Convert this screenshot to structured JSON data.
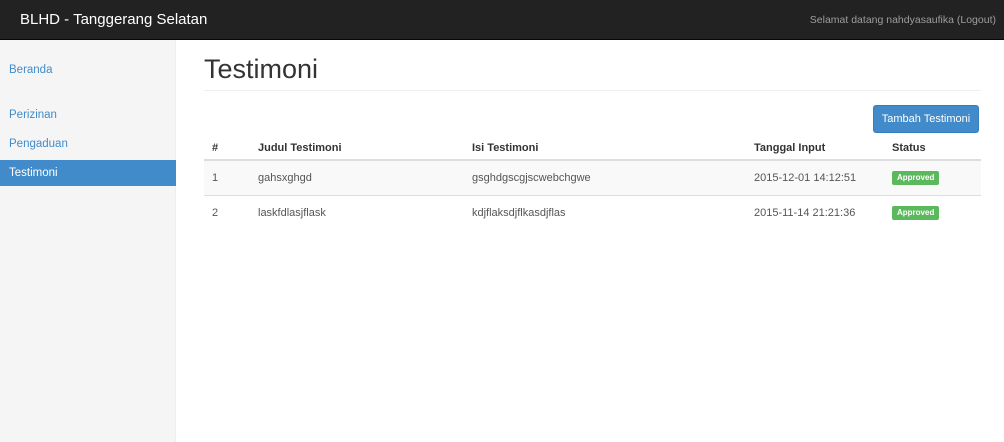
{
  "navbar": {
    "brand": "BLHD - Tanggerang Selatan",
    "welcome": "Selamat datang nahdyasaufika (Logout)"
  },
  "sidebar": {
    "items": [
      {
        "label": "Beranda",
        "active": false
      },
      {
        "label": "Perizinan",
        "active": false
      },
      {
        "label": "Pengaduan",
        "active": false
      },
      {
        "label": "Testimoni",
        "active": true
      }
    ]
  },
  "main": {
    "title": "Testimoni",
    "add_button": "Tambah Testimoni",
    "table": {
      "headers": [
        "#",
        "Judul Testimoni",
        "Isi Testimoni",
        "Tanggal Input",
        "Status"
      ],
      "rows": [
        {
          "no": "1",
          "judul": "gahsxghgd",
          "isi": "gsghdgscgjscwebchgwe",
          "tanggal": "2015-12-01 14:12:51",
          "status": "Approved"
        },
        {
          "no": "2",
          "judul": "laskfdlasjflask",
          "isi": "kdjflaksdjflkasdjflas",
          "tanggal": "2015-11-14 21:21:36",
          "status": "Approved"
        }
      ]
    }
  },
  "colors": {
    "navbar_bg": "#222222",
    "primary": "#428bca",
    "success": "#5cb85c",
    "sidebar_bg": "#f5f5f5"
  }
}
